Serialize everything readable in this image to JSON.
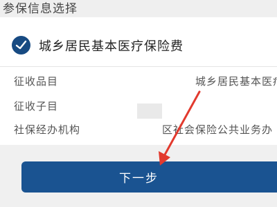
{
  "section": {
    "title": "参保信息选择"
  },
  "option": {
    "label": "城乡居民基本医疗保险费",
    "checked": true
  },
  "info": [
    {
      "label": "征收品目",
      "value": "城乡居民基本医疗"
    },
    {
      "label": "征收子目",
      "value": ""
    },
    {
      "label": "社保经办机构",
      "value": "区社会保险公共业务办"
    }
  ],
  "next_button": {
    "label": "下一步"
  },
  "colors": {
    "accent": "#1a5391",
    "arrow": "#e23a2e"
  },
  "icons": {
    "check": "check-icon",
    "annotation": "red-arrow"
  }
}
